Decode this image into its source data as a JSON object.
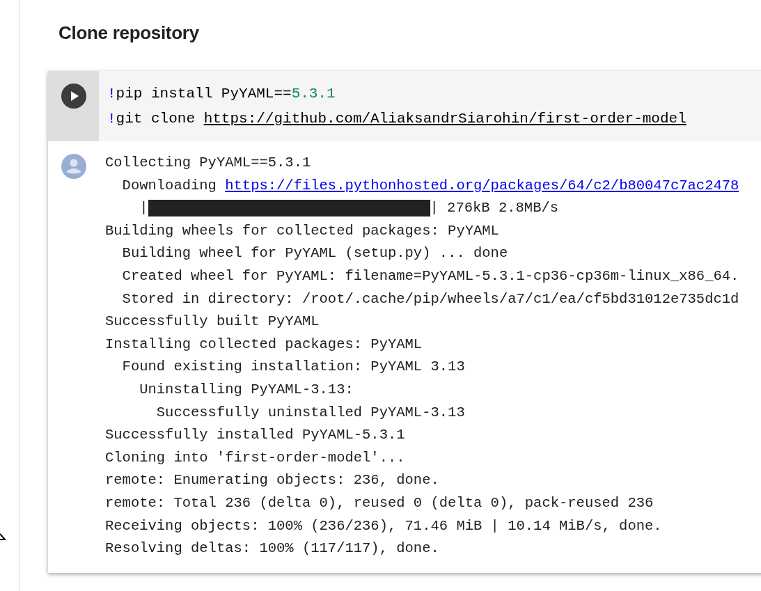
{
  "section": {
    "title": "Clone repository"
  },
  "code_cell": {
    "lines": [
      [
        {
          "kind": "bang",
          "text": "!"
        },
        {
          "kind": "plain",
          "text": "pip install PyYAML=="
        },
        {
          "kind": "number",
          "text": "5.3.1"
        }
      ],
      [
        {
          "kind": "bang",
          "text": "!"
        },
        {
          "kind": "plain",
          "text": "git clone "
        },
        {
          "kind": "link",
          "text": "https://github.com/AliaksandrSiarohin/first-order-model"
        }
      ]
    ]
  },
  "output": {
    "lines": [
      {
        "kind": "text",
        "text": "Collecting PyYAML==5.3.1"
      },
      {
        "kind": "link",
        "text": "  Downloading ",
        "link": "https://files.pythonhosted.org/packages/64/c2/b80047c7ac2478"
      },
      {
        "kind": "progress",
        "text": "    |",
        "level": 1,
        "after": "| 276kB 2.8MB/s"
      },
      {
        "kind": "text",
        "text": "Building wheels for collected packages: PyYAML"
      },
      {
        "kind": "text",
        "text": "  Building wheel for PyYAML (setup.py) ... done"
      },
      {
        "kind": "text",
        "text": "  Created wheel for PyYAML: filename=PyYAML-5.3.1-cp36-cp36m-linux_x86_64."
      },
      {
        "kind": "text",
        "text": "  Stored in directory: /root/.cache/pip/wheels/a7/c1/ea/cf5bd31012e735dc1d"
      },
      {
        "kind": "text",
        "text": "Successfully built PyYAML"
      },
      {
        "kind": "text",
        "text": "Installing collected packages: PyYAML"
      },
      {
        "kind": "text",
        "text": "  Found existing installation: PyYAML 3.13"
      },
      {
        "kind": "text",
        "text": "    Uninstalling PyYAML-3.13:"
      },
      {
        "kind": "text",
        "text": "      Successfully uninstalled PyYAML-3.13"
      },
      {
        "kind": "text",
        "text": "Successfully installed PyYAML-5.3.1"
      },
      {
        "kind": "text",
        "text": "Cloning into 'first-order-model'..."
      },
      {
        "kind": "text",
        "text": "remote: Enumerating objects: 236, done."
      },
      {
        "kind": "text",
        "text": "remote: Total 236 (delta 0), reused 0 (delta 0), pack-reused 236"
      },
      {
        "kind": "text",
        "text": "Receiving objects: 100% (236/236), 71.46 MiB | 10.14 MiB/s, done."
      },
      {
        "kind": "text",
        "text": "Resolving deltas: 100% (117/117), done."
      }
    ]
  }
}
